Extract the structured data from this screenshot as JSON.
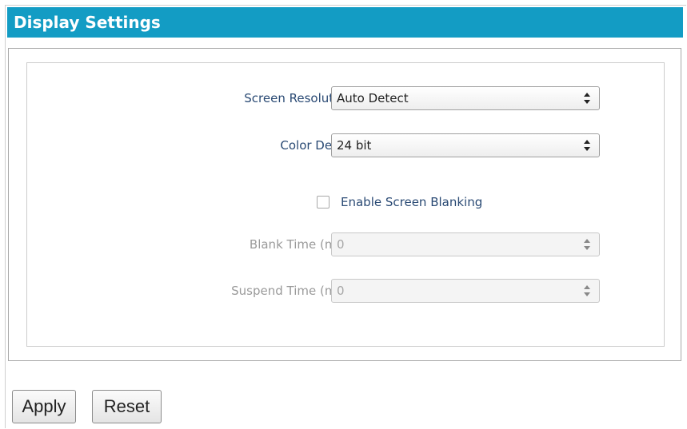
{
  "header": {
    "title": "Display Settings"
  },
  "form": {
    "screen_resolution": {
      "label": "Screen Resolution",
      "value": "Auto Detect"
    },
    "color_depth": {
      "label": "Color Depth",
      "value": "24 bit"
    },
    "screen_blanking": {
      "label": "Enable Screen Blanking",
      "checked": false
    },
    "blank_time": {
      "label": "Blank Time (min)",
      "value": "0",
      "disabled": true
    },
    "suspend_time": {
      "label": "Suspend Time (min)",
      "value": "0",
      "disabled": true
    }
  },
  "buttons": {
    "apply_label": "Apply",
    "reset_label": "Reset"
  },
  "colors": {
    "header_bg": "#139cc4",
    "label_text": "#2a4a74",
    "disabled_text": "#9a9a9a"
  },
  "icons": {
    "select_arrow": "updown-arrow-icon"
  }
}
